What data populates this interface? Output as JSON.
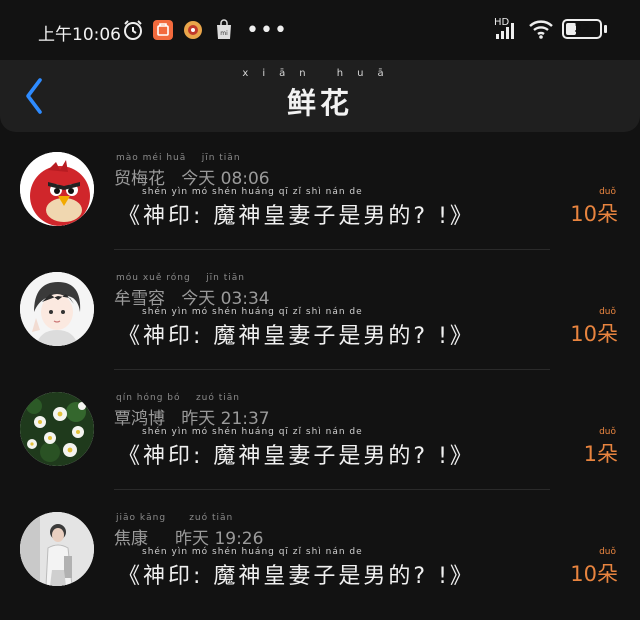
{
  "status_bar": {
    "time": "上午10:06",
    "battery": "32",
    "battery_level": 0.32,
    "network": "HD",
    "icons": [
      "alarm-icon",
      "app-orange-icon",
      "app-round-icon",
      "mi-store-icon",
      "more-dots-icon",
      "signal-icon",
      "wifi-icon",
      "battery-icon"
    ]
  },
  "header": {
    "title": "鲜花",
    "title_pinyin": "xiān huā",
    "back_icon": "chevron-left-icon"
  },
  "colors": {
    "background": "#121212",
    "header": "#1f1f1f",
    "accent": "#e8843f",
    "back": "#2e8bff"
  },
  "items": [
    {
      "name": "贸梅花",
      "name_pinyin": "mào méi huā",
      "day": "今天",
      "day_pinyin": "jīn tiān",
      "time": "08:06",
      "message": "《神印: 魔神皇妻子是男的? !》",
      "message_pinyin": "shén yìn    mó shén huáng qī zǐ shì nán de",
      "count": "10朵",
      "count_pinyin": "duǒ",
      "avatar": "red-bird-avatar"
    },
    {
      "name": "牟雪容",
      "name_pinyin": "móu xuě róng",
      "day": "今天",
      "day_pinyin": "jīn tiān",
      "time": "03:34",
      "message": "《神印: 魔神皇妻子是男的? !》",
      "message_pinyin": "shén yìn    mó shén huáng qī zǐ shì nán de",
      "count": "10朵",
      "count_pinyin": "duǒ",
      "avatar": "anime-boy-avatar"
    },
    {
      "name": "覃鸿博",
      "name_pinyin": "qín hóng bó",
      "day": "昨天",
      "day_pinyin": "zuó tiān",
      "time": "21:37",
      "message": "《神印: 魔神皇妻子是男的? !》",
      "message_pinyin": "shén yìn    mó shén huáng qī zǐ shì nán de",
      "count": "1朵",
      "count_pinyin": "duǒ",
      "avatar": "flowers-avatar"
    },
    {
      "name": "焦康",
      "name_pinyin": "jiāo kāng",
      "day": "昨天",
      "day_pinyin": "zuó tiān",
      "time": "19:26",
      "message": "《神印: 魔神皇妻子是男的? !》",
      "message_pinyin": "shén yìn    mó shén huáng qī zǐ shì nán de",
      "count": "10朵",
      "count_pinyin": "duǒ",
      "avatar": "person-photo-avatar"
    }
  ]
}
